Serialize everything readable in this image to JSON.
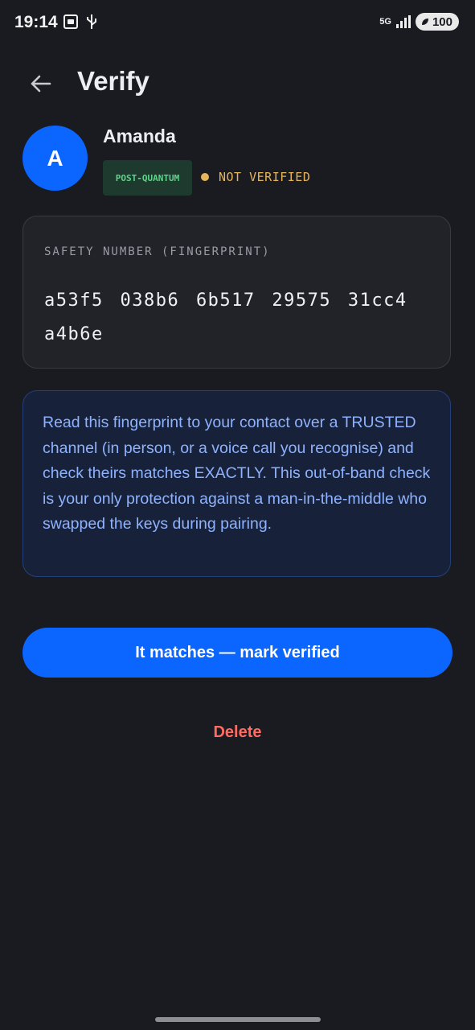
{
  "status_bar": {
    "time": "19:14",
    "network": "5G",
    "battery": "100"
  },
  "header": {
    "title": "Verify"
  },
  "contact": {
    "initial": "A",
    "name": "Amanda",
    "badge": "POST-QUANTUM",
    "status": "NOT VERIFIED"
  },
  "fingerprint": {
    "label": "SAFETY NUMBER (FINGERPRINT)",
    "value": "a53f5 038b6 6b517 29575 31cc4 a4b6e"
  },
  "info": {
    "text": "Read this fingerprint to your contact over a TRUSTED channel (in person, or a voice call you recognise) and check theirs matches EXACTLY. This out-of-band check is your only protection against a man-in-the-middle who swapped the keys during pairing."
  },
  "actions": {
    "verify_label": "It matches — mark verified",
    "delete_label": "Delete"
  },
  "colors": {
    "accent": "#0a66ff",
    "warning": "#e6b45a",
    "danger": "#ff6b63",
    "badge_text": "#5fd38a",
    "background": "#1a1b20"
  }
}
